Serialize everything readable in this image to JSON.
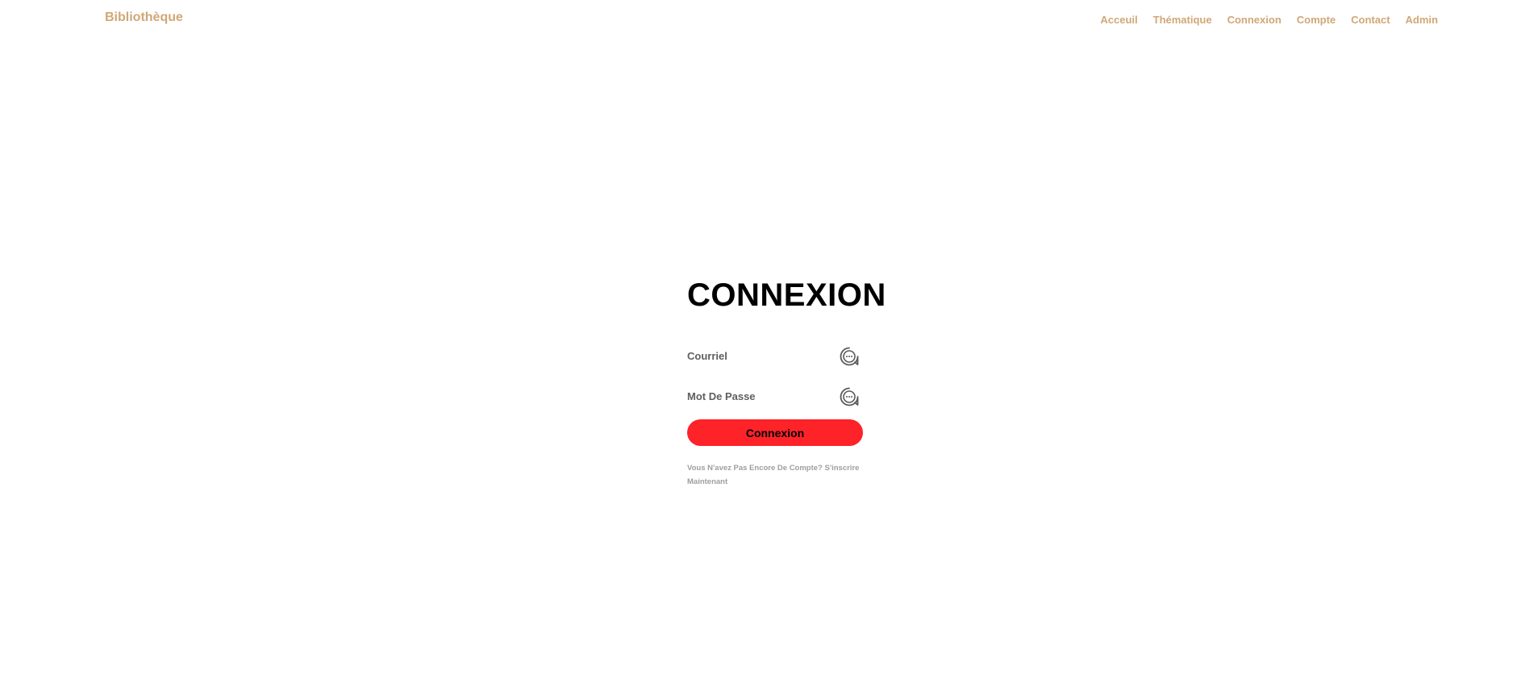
{
  "header": {
    "brand": "Bibliothèque",
    "nav": [
      {
        "label": "Acceuil"
      },
      {
        "label": "Thématique"
      },
      {
        "label": "Connexion"
      },
      {
        "label": "Compte"
      },
      {
        "label": "Contact"
      },
      {
        "label": "Admin"
      }
    ]
  },
  "login": {
    "title": "CONNEXION",
    "email": {
      "placeholder": "Courriel",
      "value": "",
      "icon": "chat-bubble-icon"
    },
    "password": {
      "placeholder": "Mot De Passe",
      "value": "",
      "icon": "chat-bubble-icon"
    },
    "submit_label": "Connexion",
    "signup_text": "Vous N'avez Pas Encore De Compte?",
    "signup_link": "S'inscrire Maintenant"
  },
  "colors": {
    "accent": "#d1a777",
    "button": "#fe2229",
    "field_text": "#5f5f5f",
    "muted": "#9e9e9e"
  }
}
